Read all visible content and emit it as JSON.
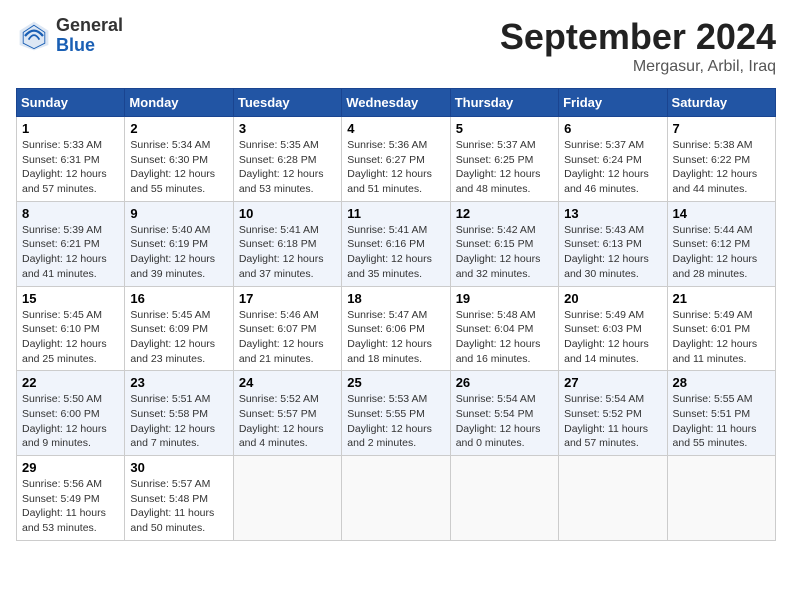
{
  "header": {
    "logo_general": "General",
    "logo_blue": "Blue",
    "month_title": "September 2024",
    "location": "Mergasur, Arbil, Iraq"
  },
  "days_of_week": [
    "Sunday",
    "Monday",
    "Tuesday",
    "Wednesday",
    "Thursday",
    "Friday",
    "Saturday"
  ],
  "weeks": [
    [
      {
        "day": "1",
        "sunrise": "5:33 AM",
        "sunset": "6:31 PM",
        "daylight": "12 hours and 57 minutes."
      },
      {
        "day": "2",
        "sunrise": "5:34 AM",
        "sunset": "6:30 PM",
        "daylight": "12 hours and 55 minutes."
      },
      {
        "day": "3",
        "sunrise": "5:35 AM",
        "sunset": "6:28 PM",
        "daylight": "12 hours and 53 minutes."
      },
      {
        "day": "4",
        "sunrise": "5:36 AM",
        "sunset": "6:27 PM",
        "daylight": "12 hours and 51 minutes."
      },
      {
        "day": "5",
        "sunrise": "5:37 AM",
        "sunset": "6:25 PM",
        "daylight": "12 hours and 48 minutes."
      },
      {
        "day": "6",
        "sunrise": "5:37 AM",
        "sunset": "6:24 PM",
        "daylight": "12 hours and 46 minutes."
      },
      {
        "day": "7",
        "sunrise": "5:38 AM",
        "sunset": "6:22 PM",
        "daylight": "12 hours and 44 minutes."
      }
    ],
    [
      {
        "day": "8",
        "sunrise": "5:39 AM",
        "sunset": "6:21 PM",
        "daylight": "12 hours and 41 minutes."
      },
      {
        "day": "9",
        "sunrise": "5:40 AM",
        "sunset": "6:19 PM",
        "daylight": "12 hours and 39 minutes."
      },
      {
        "day": "10",
        "sunrise": "5:41 AM",
        "sunset": "6:18 PM",
        "daylight": "12 hours and 37 minutes."
      },
      {
        "day": "11",
        "sunrise": "5:41 AM",
        "sunset": "6:16 PM",
        "daylight": "12 hours and 35 minutes."
      },
      {
        "day": "12",
        "sunrise": "5:42 AM",
        "sunset": "6:15 PM",
        "daylight": "12 hours and 32 minutes."
      },
      {
        "day": "13",
        "sunrise": "5:43 AM",
        "sunset": "6:13 PM",
        "daylight": "12 hours and 30 minutes."
      },
      {
        "day": "14",
        "sunrise": "5:44 AM",
        "sunset": "6:12 PM",
        "daylight": "12 hours and 28 minutes."
      }
    ],
    [
      {
        "day": "15",
        "sunrise": "5:45 AM",
        "sunset": "6:10 PM",
        "daylight": "12 hours and 25 minutes."
      },
      {
        "day": "16",
        "sunrise": "5:45 AM",
        "sunset": "6:09 PM",
        "daylight": "12 hours and 23 minutes."
      },
      {
        "day": "17",
        "sunrise": "5:46 AM",
        "sunset": "6:07 PM",
        "daylight": "12 hours and 21 minutes."
      },
      {
        "day": "18",
        "sunrise": "5:47 AM",
        "sunset": "6:06 PM",
        "daylight": "12 hours and 18 minutes."
      },
      {
        "day": "19",
        "sunrise": "5:48 AM",
        "sunset": "6:04 PM",
        "daylight": "12 hours and 16 minutes."
      },
      {
        "day": "20",
        "sunrise": "5:49 AM",
        "sunset": "6:03 PM",
        "daylight": "12 hours and 14 minutes."
      },
      {
        "day": "21",
        "sunrise": "5:49 AM",
        "sunset": "6:01 PM",
        "daylight": "12 hours and 11 minutes."
      }
    ],
    [
      {
        "day": "22",
        "sunrise": "5:50 AM",
        "sunset": "6:00 PM",
        "daylight": "12 hours and 9 minutes."
      },
      {
        "day": "23",
        "sunrise": "5:51 AM",
        "sunset": "5:58 PM",
        "daylight": "12 hours and 7 minutes."
      },
      {
        "day": "24",
        "sunrise": "5:52 AM",
        "sunset": "5:57 PM",
        "daylight": "12 hours and 4 minutes."
      },
      {
        "day": "25",
        "sunrise": "5:53 AM",
        "sunset": "5:55 PM",
        "daylight": "12 hours and 2 minutes."
      },
      {
        "day": "26",
        "sunrise": "5:54 AM",
        "sunset": "5:54 PM",
        "daylight": "12 hours and 0 minutes."
      },
      {
        "day": "27",
        "sunrise": "5:54 AM",
        "sunset": "5:52 PM",
        "daylight": "11 hours and 57 minutes."
      },
      {
        "day": "28",
        "sunrise": "5:55 AM",
        "sunset": "5:51 PM",
        "daylight": "11 hours and 55 minutes."
      }
    ],
    [
      {
        "day": "29",
        "sunrise": "5:56 AM",
        "sunset": "5:49 PM",
        "daylight": "11 hours and 53 minutes."
      },
      {
        "day": "30",
        "sunrise": "5:57 AM",
        "sunset": "5:48 PM",
        "daylight": "11 hours and 50 minutes."
      },
      null,
      null,
      null,
      null,
      null
    ]
  ]
}
